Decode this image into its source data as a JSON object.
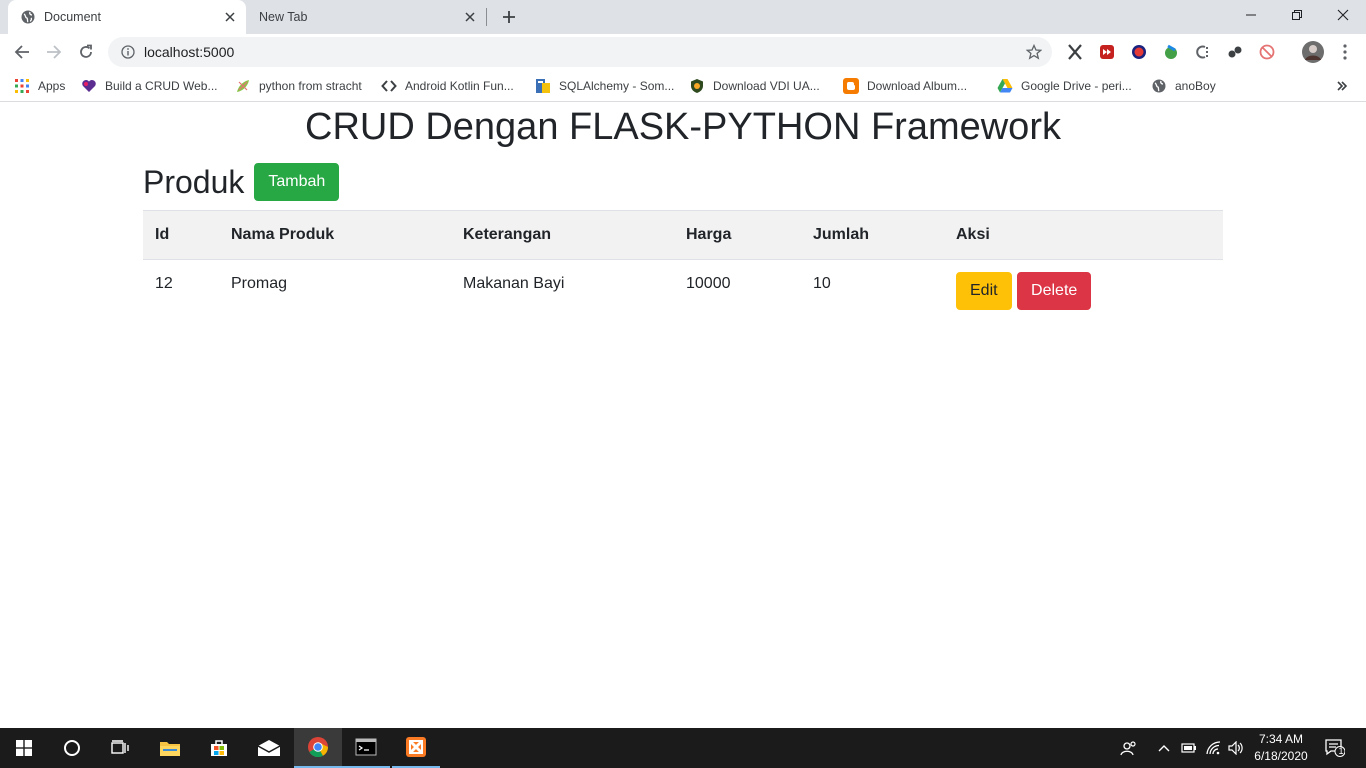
{
  "browser": {
    "tabs": [
      {
        "title": "Document",
        "active": true
      },
      {
        "title": "New Tab",
        "active": false
      }
    ],
    "url": "localhost:5000",
    "bookmarks": [
      {
        "label": "Apps"
      },
      {
        "label": "Build a CRUD Web..."
      },
      {
        "label": "python from stracht"
      },
      {
        "label": "Android Kotlin Fun..."
      },
      {
        "label": "SQLAlchemy - Som..."
      },
      {
        "label": "Download VDI UA..."
      },
      {
        "label": "Download Album..."
      },
      {
        "label": "Google Drive - peri..."
      },
      {
        "label": "anoBoy"
      }
    ]
  },
  "page": {
    "heading": "CRUD Dengan FLASK-PYTHON Framework",
    "section_title": "Produk",
    "add_button": "Tambah",
    "table": {
      "headers": [
        "Id",
        "Nama Produk",
        "Keterangan",
        "Harga",
        "Jumlah",
        "Aksi"
      ],
      "rows": [
        {
          "id": "12",
          "nama": "Promag",
          "keterangan": "Makanan Bayi",
          "harga": "10000",
          "jumlah": "10"
        }
      ],
      "edit_label": "Edit",
      "delete_label": "Delete"
    }
  },
  "taskbar": {
    "time": "7:34 AM",
    "date": "6/18/2020",
    "notification_count": "1"
  },
  "colors": {
    "success": "#28a745",
    "warning": "#ffc107",
    "danger": "#dc3545",
    "table_header_bg": "#f2f2f2"
  }
}
